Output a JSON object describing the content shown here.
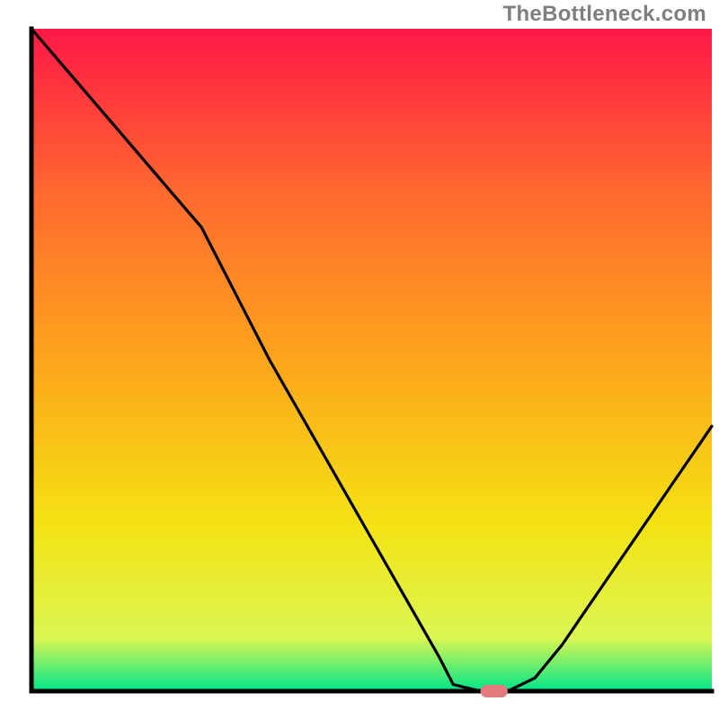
{
  "watermark": "TheBottleneck.com",
  "colors": {
    "gradient_top": "#ff1846",
    "gradient_q1": "#ff6a2f",
    "gradient_mid": "#fda51c",
    "gradient_q3": "#f4e313",
    "gradient_near_bottom": "#dbf753",
    "gradient_bottom": "#00e588",
    "axis": "#000000",
    "curve": "#000000",
    "marker_fill": "#e37a7e",
    "watermark": "#7f7f7f"
  },
  "chart_data": {
    "type": "line",
    "title": "",
    "xlabel": "",
    "ylabel": "",
    "xlim": [
      0,
      100
    ],
    "ylim": [
      0,
      100
    ],
    "series": [
      {
        "name": "curve",
        "x": [
          0,
          5,
          10,
          15,
          20,
          25,
          30,
          35,
          40,
          45,
          50,
          55,
          60,
          62,
          66,
          70,
          74,
          78,
          82,
          86,
          90,
          94,
          98,
          100
        ],
        "y": [
          100,
          94,
          88,
          82,
          76,
          70,
          60,
          50,
          41,
          32,
          23,
          14,
          5,
          1,
          0,
          0,
          2,
          7,
          13,
          19,
          25,
          31,
          37,
          40
        ]
      }
    ],
    "marker": {
      "x_range": [
        66,
        70
      ],
      "y": 0
    },
    "watermark_text": "TheBottleneck.com"
  }
}
